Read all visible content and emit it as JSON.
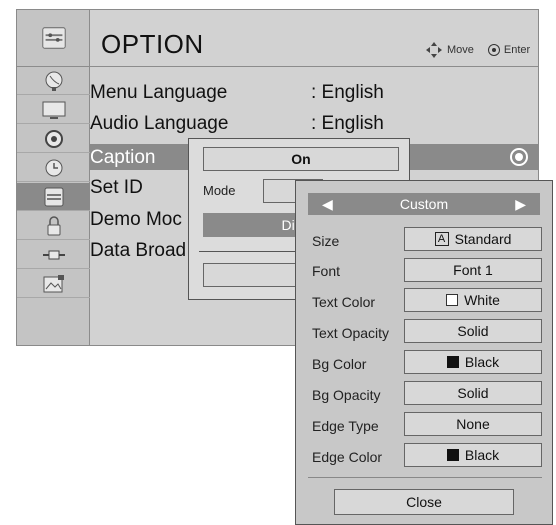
{
  "menu": {
    "title": "OPTION",
    "hint_move": "Move",
    "hint_enter": "Enter",
    "rows": [
      {
        "label": "Menu Language",
        "value": ": English"
      },
      {
        "label": "Audio Language",
        "value": ": English"
      },
      {
        "label": "Caption",
        "value": ""
      },
      {
        "label": "Set ID",
        "value": ""
      },
      {
        "label": "Demo Moc",
        "value": ""
      },
      {
        "label": "Data Broad",
        "value": ""
      }
    ]
  },
  "sidebar": {
    "icons": [
      "option-icon",
      "satellite-dish-icon",
      "tv-picture-icon",
      "audio-speaker-icon",
      "clock-icon",
      "option-icon",
      "lock-icon",
      "input-plug-icon",
      "usb-photo-icon"
    ]
  },
  "mode_popup": {
    "toggle_value": "On",
    "mode_label": "Mode",
    "digital_label": "Digital",
    "close_partial": "Cl"
  },
  "custom_panel": {
    "selector_value": "Custom",
    "settings": [
      {
        "label": "Size",
        "value": "Standard",
        "icon": "a-letter-icon"
      },
      {
        "label": "Font",
        "value": "Font 1",
        "icon": ""
      },
      {
        "label": "Text Color",
        "value": "White",
        "icon": "white-swatch"
      },
      {
        "label": "Text Opacity",
        "value": "Solid",
        "icon": ""
      },
      {
        "label": "Bg Color",
        "value": "Black",
        "icon": "black-swatch"
      },
      {
        "label": "Bg Opacity",
        "value": "Solid",
        "icon": ""
      },
      {
        "label": "Edge Type",
        "value": "None",
        "icon": ""
      },
      {
        "label": "Edge Color",
        "value": "Black",
        "icon": "black-swatch"
      }
    ],
    "close_label": "Close"
  },
  "colors": {
    "menu_bg": "#d2d2d2",
    "highlight": "#8a8a8a",
    "panel_bg": "#c8c8c8"
  }
}
